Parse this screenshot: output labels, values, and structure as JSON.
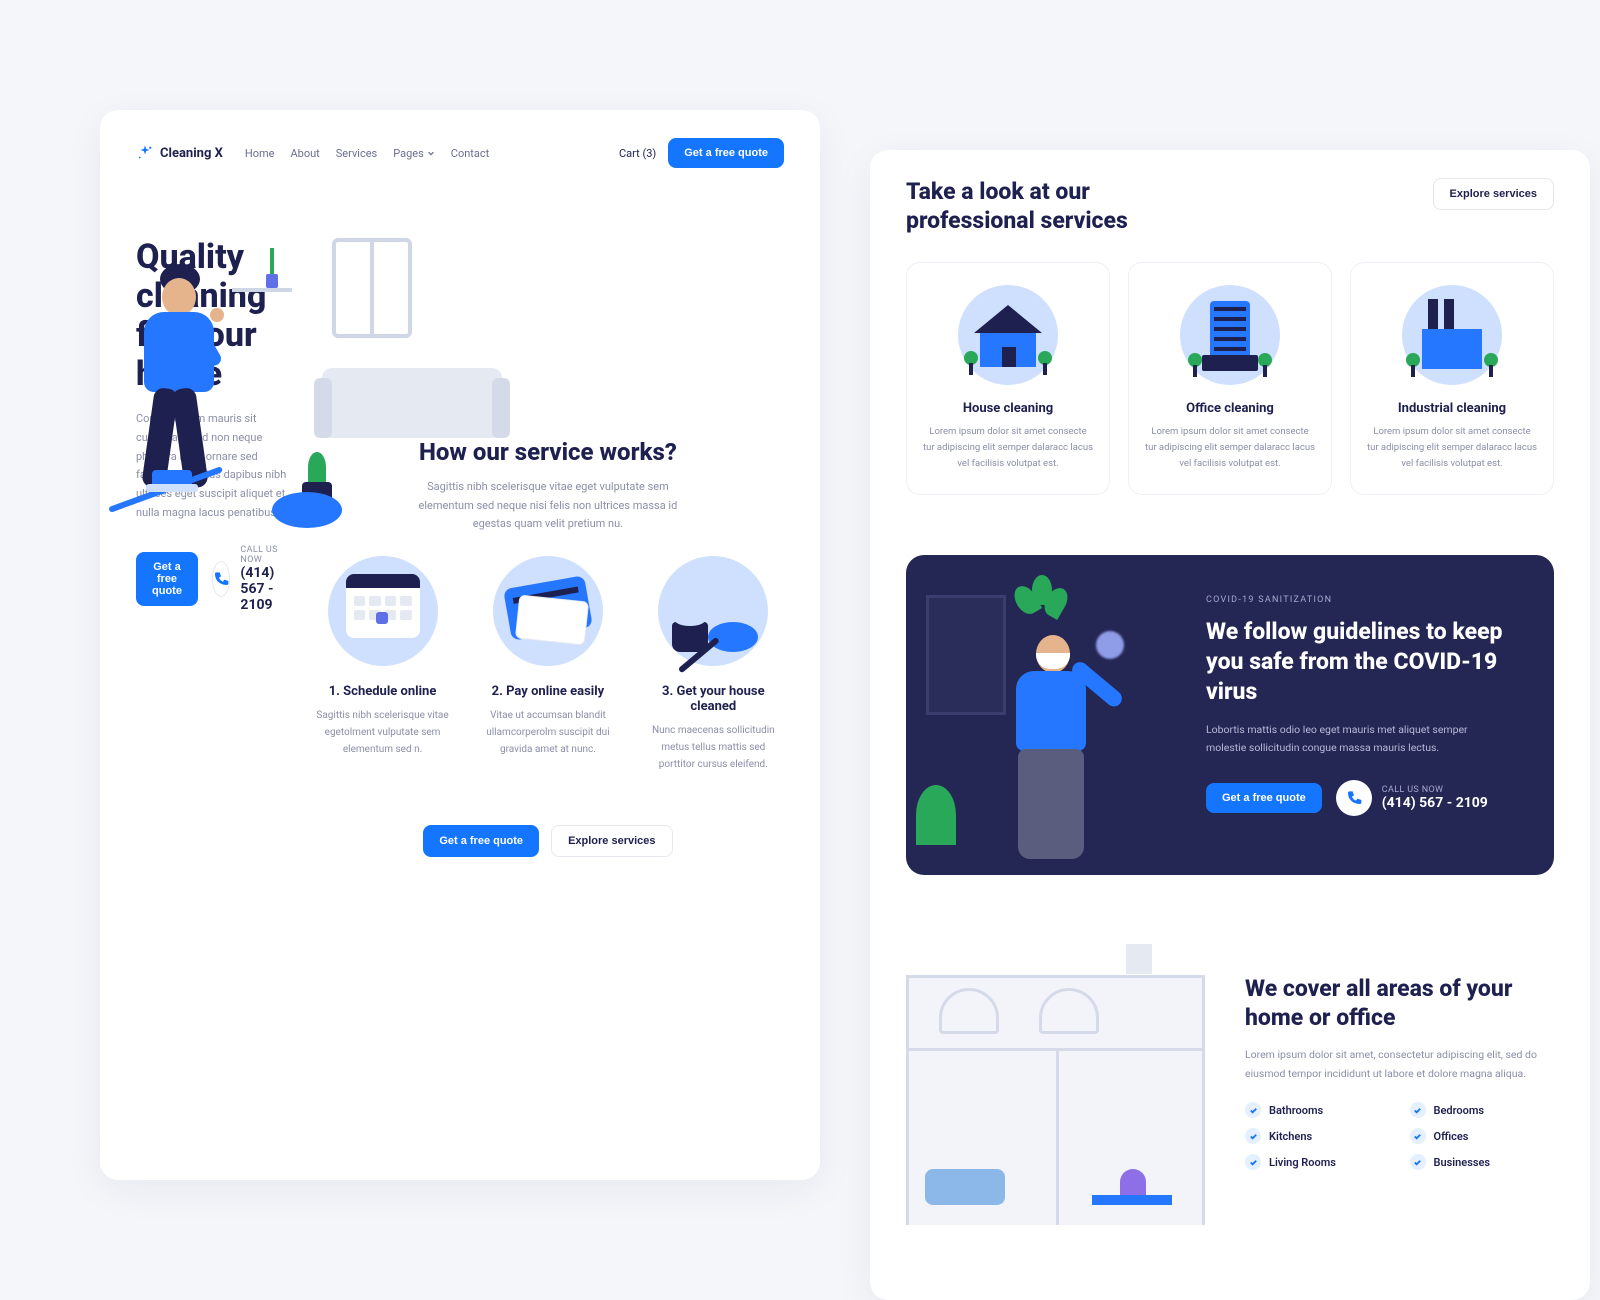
{
  "brand": {
    "name": "Cleaning X"
  },
  "nav": {
    "items": [
      "Home",
      "About",
      "Services",
      "Pages",
      "Contact"
    ],
    "cart": "Cart (3)",
    "cta": "Get a free quote"
  },
  "hero": {
    "title": "Quality cleaning for your home",
    "subtitle": "Condimentum mauris sit cursus amet id non neque pharetra nulla ornare sed facilisis senectus dapibus nibh ultrices eget suscipit aliquet et nulla magna lacus penatibus.",
    "cta": "Get a free quote",
    "call_label": "CALL US NOW",
    "phone": "(414) 567 - 2109"
  },
  "how": {
    "title": "How our service works?",
    "subtitle": "Sagittis nibh scelerisque vitae eget vulputate sem elementum sed neque nisi felis non ultrices massa id egestas quam velit pretium nu.",
    "steps": [
      {
        "title": "1. Schedule online",
        "text": "Sagittis nibh scelerisque vitae egetolment vulputate sem elementum sed n."
      },
      {
        "title": "2. Pay online easily",
        "text": "Vitae ut accumsan blandit ullamcorperolm suscipit dui gravida amet at nunc."
      },
      {
        "title": "3. Get your house cleaned",
        "text": "Nunc maecenas sollicitudin metus tellus mattis sed porttitor cursus eleifend."
      }
    ],
    "cta1": "Get a free quote",
    "cta2": "Explore services"
  },
  "services": {
    "title": "Take a look at our professional services",
    "cta": "Explore services",
    "cards": [
      {
        "title": "House cleaning",
        "text": "Lorem ipsum dolor sit amet consecte tur adipiscing elit semper dalaracc lacus vel facilisis volutpat est."
      },
      {
        "title": "Office cleaning",
        "text": "Lorem ipsum dolor sit amet consecte tur adipiscing elit semper dalaracc lacus vel facilisis volutpat est."
      },
      {
        "title": "Industrial cleaning",
        "text": "Lorem ipsum dolor sit amet consecte tur adipiscing elit semper dalaracc lacus vel facilisis volutpat est."
      }
    ]
  },
  "covid": {
    "tag": "COVID-19 SANITIZATION",
    "title": "We follow guidelines to keep you safe from the COVID-19 virus",
    "text": "Lobortis mattis odio leo eget mauris met aliquet semper molestie sollicitudin congue massa mauris lectus.",
    "cta": "Get a free quote",
    "call_label": "CALL US NOW",
    "phone": "(414) 567 - 2109"
  },
  "areas": {
    "title": "We cover all areas of your home or office",
    "text": "Lorem ipsum dolor sit amet, consectetur adipiscing elit, sed do eiusmod tempor incididunt ut labore et dolore magna aliqua.",
    "items": [
      "Bathrooms",
      "Bedrooms",
      "Kitchens",
      "Offices",
      "Living Rooms",
      "Businesses"
    ]
  },
  "colors": {
    "primary": "#1476ff",
    "dark": "#1e2050",
    "muted": "#8b8ea8",
    "lightblue": "#cfe0ff",
    "green": "#2aa85a"
  }
}
